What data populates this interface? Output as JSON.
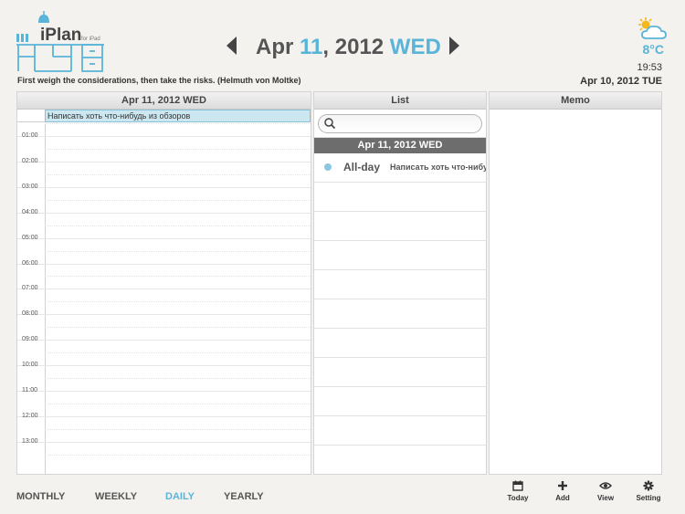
{
  "app": {
    "name": "iPlan",
    "subtitle": "for iPad"
  },
  "header": {
    "date_month": "Apr",
    "date_day": "11",
    "date_year": ", 2012",
    "date_weekday": "WED",
    "temperature": "8°C",
    "clock": "19:53",
    "today": "Apr 10, 2012 TUE",
    "quote": "First weigh the considerations, then take the risks. (Helmuth von Moltke)"
  },
  "day_panel": {
    "title": "Apr 11, 2012 WED",
    "allday_event": "Написать хоть что-нибудь из обзоров",
    "hours": [
      "01:00",
      "02:00",
      "03:00",
      "04:00",
      "05:00",
      "06:00",
      "07:00",
      "08:00",
      "09:00",
      "10:00",
      "11:00",
      "12:00",
      "13:00"
    ]
  },
  "list_panel": {
    "title": "List",
    "search_placeholder": "",
    "date": "Apr 11, 2012 WED",
    "items": [
      {
        "type": "All-day",
        "text": "Написать хоть что-нибудь из обзоров"
      }
    ]
  },
  "memo_panel": {
    "title": "Memo"
  },
  "modes": [
    {
      "label": "MONTHLY",
      "active": false
    },
    {
      "label": "WEEKLY",
      "active": false
    },
    {
      "label": "DAILY",
      "active": true
    },
    {
      "label": "YEARLY",
      "active": false
    }
  ],
  "toolbar": {
    "today_label": "Today",
    "add_label": "Add",
    "view_label": "View",
    "setting_label": "Setting"
  },
  "colors": {
    "accent": "#5ab4d8",
    "list_header": "#6d6d6d",
    "event_fill": "#cde7f1"
  },
  "icons": [
    "lamp-icon",
    "prev-arrow-icon",
    "next-arrow-icon",
    "weather-sun-cloud-icon",
    "search-icon",
    "calendar-icon",
    "plus-icon",
    "eye-icon",
    "gear-icon"
  ]
}
